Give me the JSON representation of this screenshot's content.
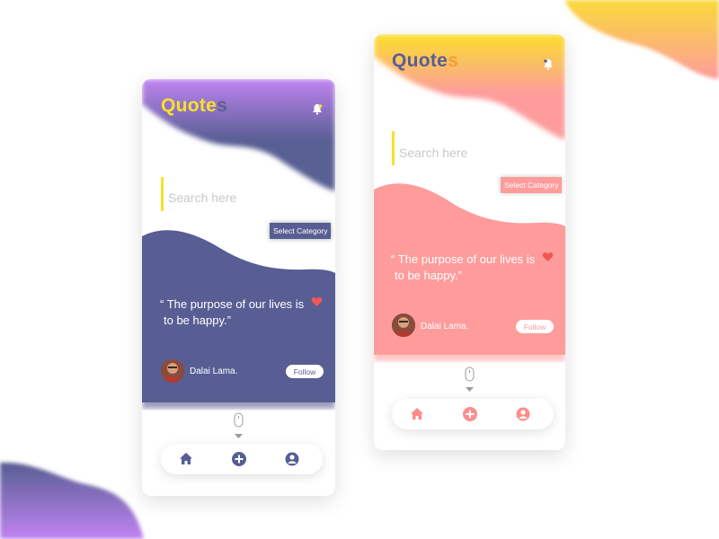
{
  "colors": {
    "purple_theme": "#585e93",
    "purple_accent": "#c084f2",
    "pink_theme": "#fe9c9c",
    "yellow_accent": "#f9e02b",
    "heart_red": "#f05656"
  },
  "screens": [
    {
      "theme": "purple",
      "logo": {
        "main": "Quote",
        "last": "s"
      },
      "search": {
        "placeholder": "Search here"
      },
      "select_category": "Select Category",
      "quote_line1": "“ The purpose of our lives is",
      "quote_line2": "to be happy.”",
      "author": "Dalai Lama.",
      "follow": "Follow",
      "icons": [
        "bell-icon",
        "heart-icon",
        "mouse-icon",
        "chevron-down-icon",
        "home-icon",
        "add-icon",
        "user-icon"
      ]
    },
    {
      "theme": "pink",
      "logo": {
        "main": "Quote",
        "last": "s"
      },
      "search": {
        "placeholder": "Search here"
      },
      "select_category": "Select Category",
      "quote_line1": "“ The purpose of our lives is",
      "quote_line2": "to be happy.”",
      "author": "Dalai Lama.",
      "follow": "Follow",
      "icons": [
        "bell-icon",
        "heart-icon",
        "mouse-icon",
        "chevron-down-icon",
        "home-icon",
        "add-icon",
        "user-icon"
      ]
    }
  ]
}
